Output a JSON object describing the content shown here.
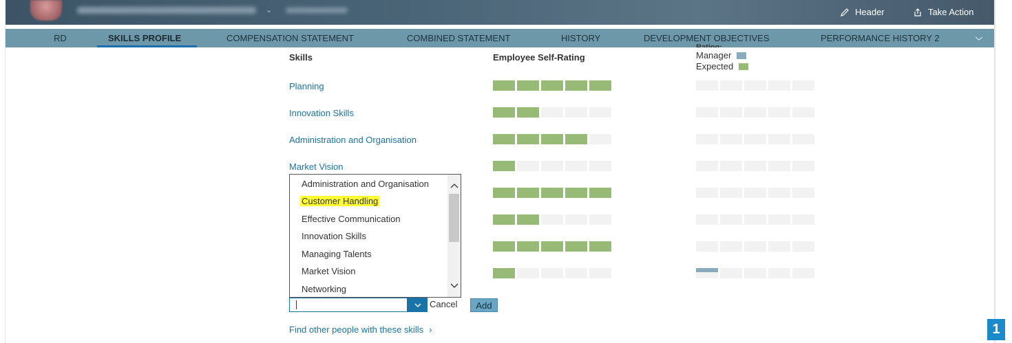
{
  "header": {
    "actions": [
      {
        "label": "Header",
        "icon": "pencil-icon"
      },
      {
        "label": "Take Action",
        "icon": "share-icon"
      }
    ]
  },
  "tabs": [
    {
      "label": "RD",
      "active": false
    },
    {
      "label": "SKILLS PROFILE",
      "active": true
    },
    {
      "label": "COMPENSATION STATEMENT",
      "active": false
    },
    {
      "label": "COMBINED STATEMENT",
      "active": false
    },
    {
      "label": "HISTORY",
      "active": false
    },
    {
      "label": "DEVELOPMENT OBJECTIVES",
      "active": false
    },
    {
      "label": "PERFORMANCE HISTORY 2",
      "active": false
    }
  ],
  "table": {
    "col_skills": "Skills",
    "col_self": "Employee Self-Rating",
    "col_rating_partial": "Rating:",
    "legend": [
      {
        "label": "Manager",
        "color": "#8aabbd"
      },
      {
        "label": "Expected",
        "color": "#97ba77"
      }
    ],
    "rows": [
      {
        "skill": "Planning",
        "self": 5,
        "manager": 0
      },
      {
        "skill": "Innovation Skills",
        "self": 2,
        "manager": 0
      },
      {
        "skill": "Administration and Organisation",
        "self": 4,
        "manager": 0
      },
      {
        "skill": "Market Vision",
        "self": 1,
        "manager": 0
      },
      {
        "skill": "",
        "self": 5,
        "manager": 0
      },
      {
        "skill": "",
        "self": 2,
        "manager": 0
      },
      {
        "skill": "",
        "self": 5,
        "manager": 0
      },
      {
        "skill": "",
        "self": 1,
        "manager": 1
      }
    ],
    "max_rating": 5
  },
  "dropdown": {
    "options": [
      "Administration and Organisation",
      "Customer Handling",
      "Effective Communication",
      "Innovation Skills",
      "Managing Talents",
      "Market Vision",
      "Networking"
    ],
    "highlighted": "Customer Handling",
    "input_value": "",
    "cancel_label": "Cancel",
    "add_label": "Add"
  },
  "find_link": "Find other people with these skills",
  "scroll_top_label": "1",
  "colors": {
    "self_rating": "#97ba77",
    "manager_rating": "#8aabbd",
    "link": "#1a73a8",
    "tabbar": "#6d98a9"
  }
}
